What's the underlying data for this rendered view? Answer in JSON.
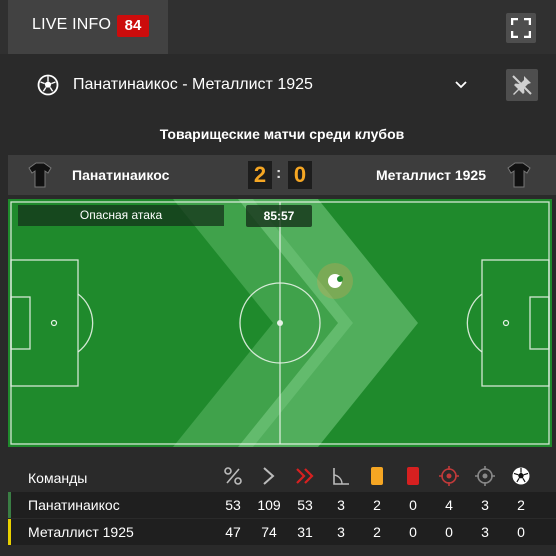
{
  "header": {
    "tab_label": "LIVE INFO",
    "badge": "84"
  },
  "match": {
    "title": "Панатинаикос - Металлист 1925",
    "tournament": "Товарищеские матчи среди клубов"
  },
  "score": {
    "home_team": "Панатинаикос",
    "away_team": "Металлист 1925",
    "home": "2",
    "separator": ":",
    "away": "0"
  },
  "field": {
    "event": "Опасная атака",
    "time": "85:57"
  },
  "stats": {
    "column_label": "Команды",
    "icons": [
      "percent-icon",
      "attack-arrow-icon",
      "dangerous-attack-icon",
      "corner-icon",
      "yellow-card-icon",
      "red-card-icon",
      "shot-on-target-icon",
      "shot-off-target-icon",
      "goal-ball-icon"
    ],
    "rows": [
      {
        "team": "Панатинаикос",
        "color": "#3a7d44",
        "values": [
          "53",
          "109",
          "53",
          "3",
          "2",
          "0",
          "4",
          "3",
          "2"
        ]
      },
      {
        "team": "Металлист 1925",
        "color": "#e8d000",
        "values": [
          "47",
          "74",
          "31",
          "3",
          "2",
          "0",
          "0",
          "3",
          "0"
        ]
      }
    ]
  },
  "colors": {
    "accent_score": "#f5a623",
    "badge_red": "#cc0c0c",
    "pitch": "#1f8a2c"
  }
}
